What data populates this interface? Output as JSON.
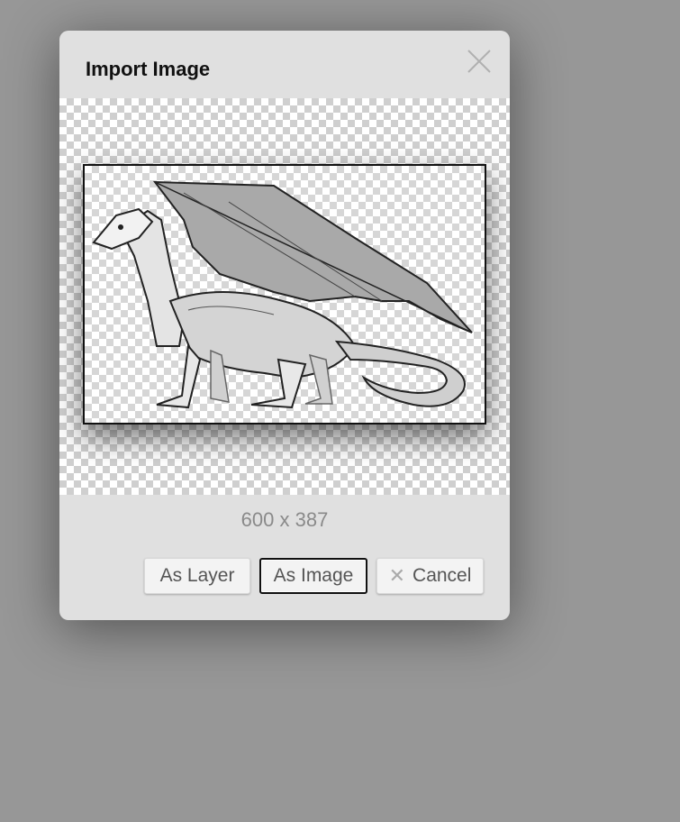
{
  "dialog": {
    "title": "Import Image",
    "close_icon": "close-icon",
    "dimensions": "600 x 387",
    "buttons": {
      "as_layer": "As Layer",
      "as_image": "As Image",
      "cancel": "Cancel",
      "cancel_icon": "x-icon"
    }
  },
  "colors": {
    "backdrop": "#979797",
    "dialog_bg": "#e0e0e0",
    "focus_border": "#111111"
  }
}
